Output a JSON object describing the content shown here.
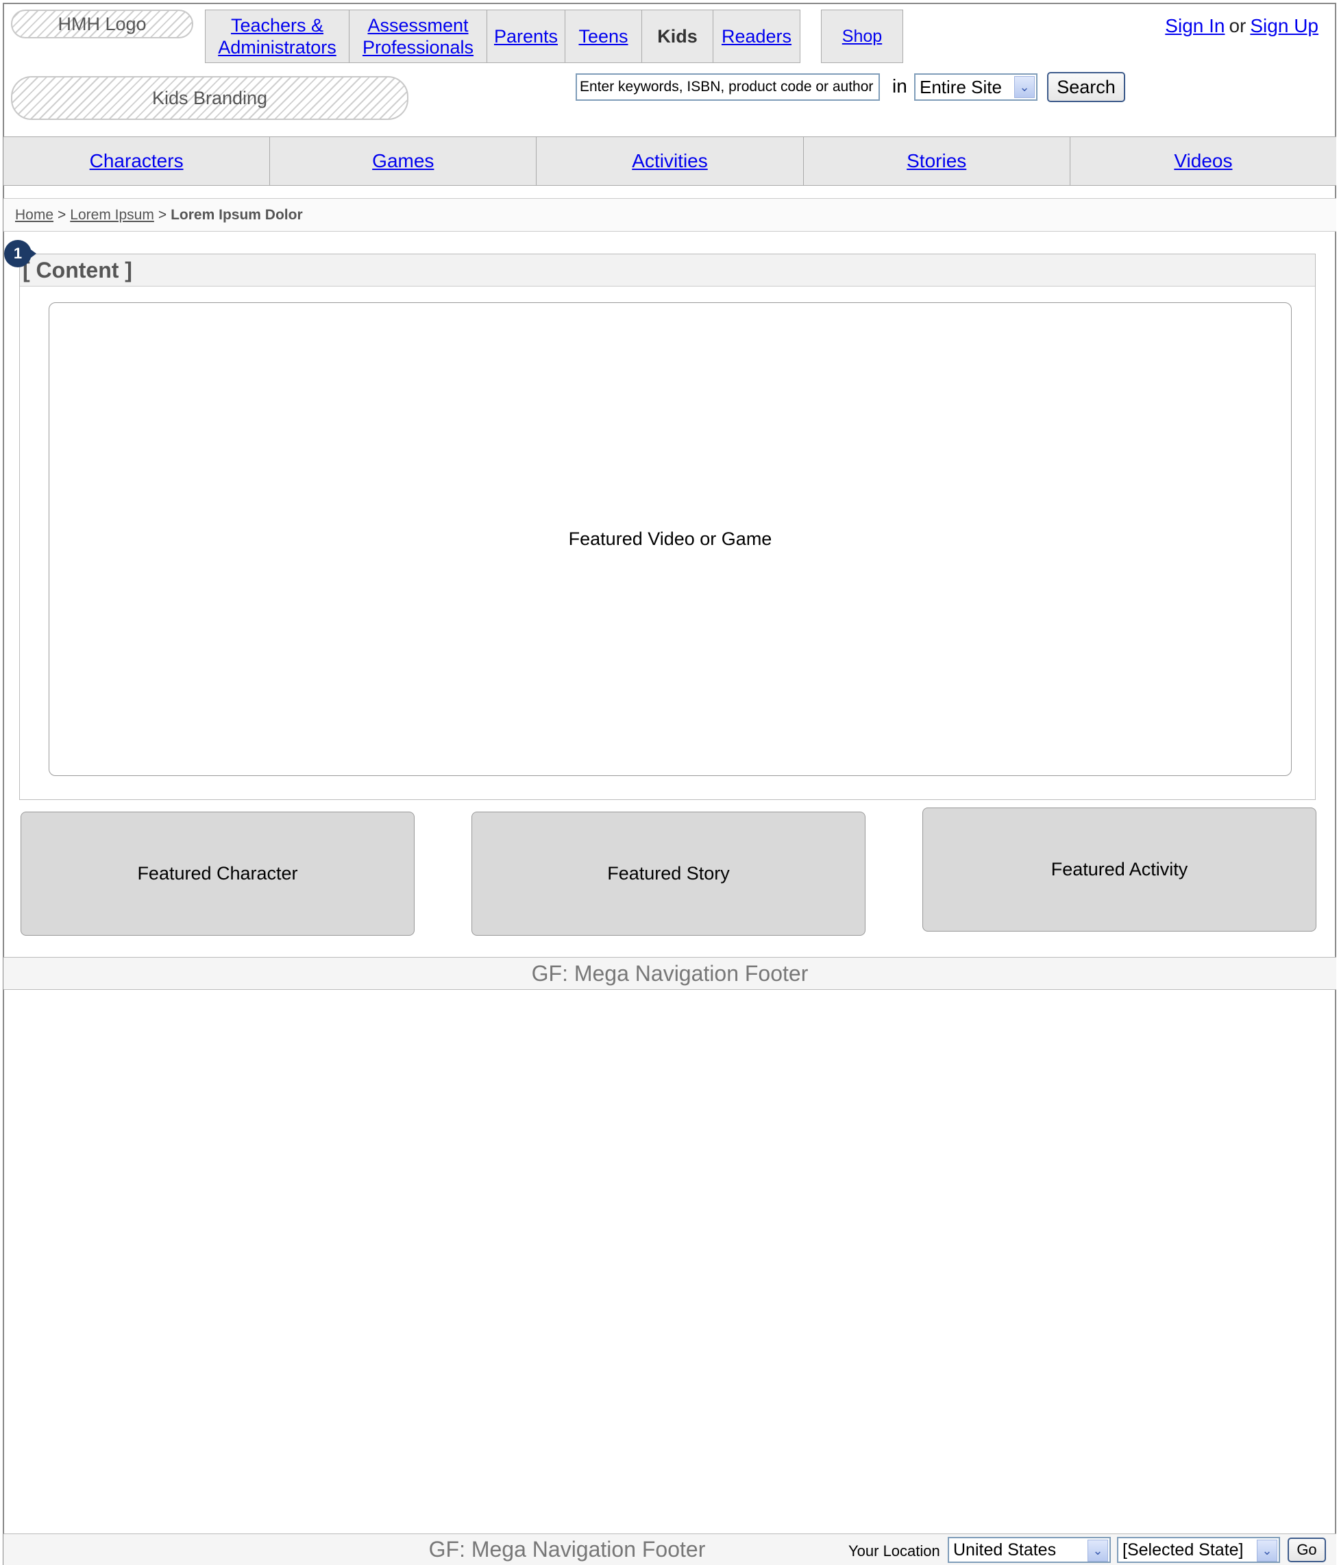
{
  "header": {
    "logo_text": "HMH Logo",
    "branding_text": "Kids Branding",
    "audience_tabs": [
      {
        "label": "Teachers & Administrators",
        "active": false
      },
      {
        "label": "Assessment Professionals",
        "active": false
      },
      {
        "label": "Parents",
        "active": false
      },
      {
        "label": "Teens",
        "active": false
      },
      {
        "label": "Kids",
        "active": true
      },
      {
        "label": "Readers",
        "active": false
      }
    ],
    "shop_label": "Shop",
    "sign_in": "Sign In",
    "auth_separator": "or",
    "sign_up": "Sign Up"
  },
  "search": {
    "value": "Enter keywords, ISBN, product code or author",
    "in_label": "in",
    "scope": "Entire Site",
    "button": "Search"
  },
  "section_nav": [
    "Characters",
    "Games",
    "Activities",
    "Stories",
    "Videos"
  ],
  "breadcrumb": {
    "home": "Home",
    "separator": ">",
    "level1": "Lorem Ipsum",
    "current": "Lorem Ipsum Dolor"
  },
  "content": {
    "marker_number": "1",
    "header": "[ Content ]",
    "featured_main": "Featured Video or Game",
    "cards": {
      "character": "Featured Character",
      "story": "Featured Story",
      "activity": "Featured Activity"
    }
  },
  "footer": {
    "label_1": "GF: Mega Navigation Footer",
    "label_2": "GF: Mega Navigation Footer",
    "location_label": "Your Location",
    "country": "United States",
    "state": "[Selected State]",
    "go": "Go"
  },
  "colors": {
    "link": "#0000ee",
    "marker": "#1d3a66",
    "tab_bg": "#e9e9e9",
    "card_bg": "#d9d9d9"
  }
}
